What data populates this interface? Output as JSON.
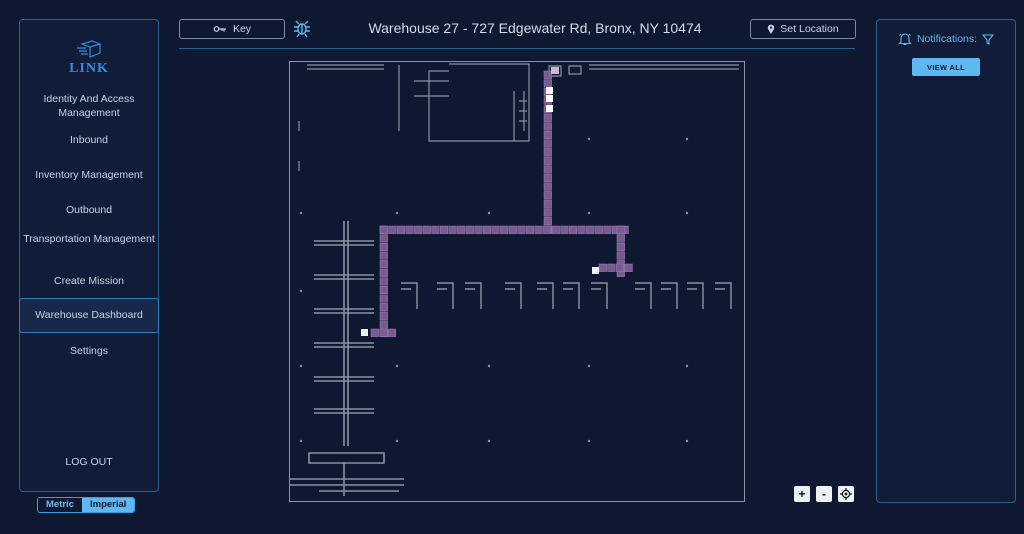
{
  "app": {
    "logo_text": "LINK"
  },
  "sidebar": {
    "items": [
      {
        "label": "Identity And Access Management",
        "active": false
      },
      {
        "label": "Inbound",
        "active": false
      },
      {
        "label": "Inventory Management",
        "active": false
      },
      {
        "label": "Outbound",
        "active": false
      },
      {
        "label": "Transportation Management",
        "active": false
      },
      {
        "label": "Create Mission",
        "active": false
      },
      {
        "label": "Warehouse Dashboard",
        "active": true
      },
      {
        "label": "Settings",
        "active": false
      }
    ],
    "logout_label": "LOG OUT"
  },
  "units": {
    "metric_label": "Metric",
    "imperial_label": "Imperial",
    "selected": "Imperial"
  },
  "header": {
    "key_label": "Key",
    "title": "Warehouse 27 - 727 Edgewater Rd, Bronx, NY 10474",
    "set_location_label": "Set Location",
    "icons": [
      "key-icon",
      "bug-settings-icon",
      "location-pin-icon"
    ]
  },
  "map": {
    "zoom_in_label": "+",
    "zoom_out_label": "-",
    "icons": [
      "recenter-icon"
    ],
    "colors": {
      "path": "#7a5a90",
      "path_border": "#a080b8",
      "walls": "#8a93a3",
      "background": "#0e1830"
    }
  },
  "notifications": {
    "title": "Notifications:",
    "view_all_label": "VIEW ALL",
    "icons": [
      "bell-icon",
      "filter-icon"
    ]
  },
  "colors": {
    "accent": "#5fb8f0",
    "panel_border": "#2b5f8c",
    "background": "#0e1830"
  }
}
